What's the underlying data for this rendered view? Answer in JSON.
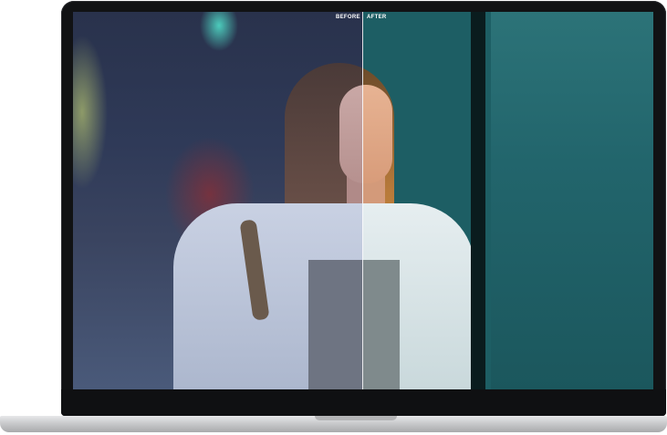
{
  "comparison": {
    "before_label": "BEFORE",
    "after_label": "AFTER",
    "split_position": 0.5
  },
  "colors": {
    "device_bezel": "#111214",
    "device_base": "#c9cacc",
    "after_tint": "#22656c",
    "before_tint": "#2f3a58"
  },
  "icons": {
    "divider": "split-handle-line"
  }
}
